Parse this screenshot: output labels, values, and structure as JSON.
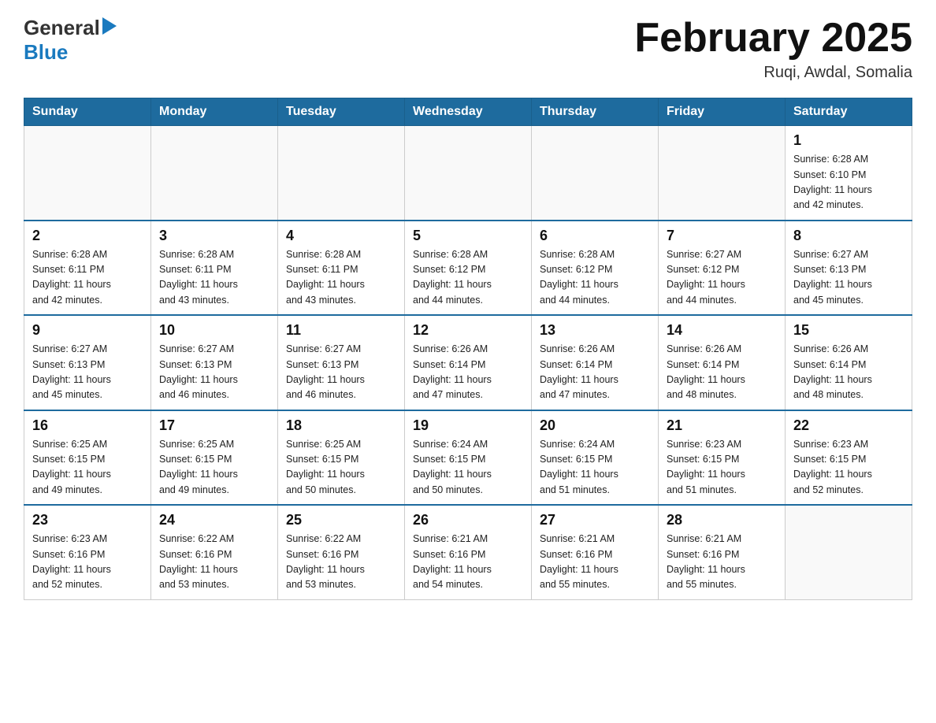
{
  "header": {
    "logo_general": "General",
    "logo_blue": "Blue",
    "month_title": "February 2025",
    "location": "Ruqi, Awdal, Somalia"
  },
  "weekdays": [
    "Sunday",
    "Monday",
    "Tuesday",
    "Wednesday",
    "Thursday",
    "Friday",
    "Saturday"
  ],
  "weeks": [
    {
      "days": [
        {
          "num": "",
          "info": ""
        },
        {
          "num": "",
          "info": ""
        },
        {
          "num": "",
          "info": ""
        },
        {
          "num": "",
          "info": ""
        },
        {
          "num": "",
          "info": ""
        },
        {
          "num": "",
          "info": ""
        },
        {
          "num": "1",
          "info": "Sunrise: 6:28 AM\nSunset: 6:10 PM\nDaylight: 11 hours\nand 42 minutes."
        }
      ]
    },
    {
      "days": [
        {
          "num": "2",
          "info": "Sunrise: 6:28 AM\nSunset: 6:11 PM\nDaylight: 11 hours\nand 42 minutes."
        },
        {
          "num": "3",
          "info": "Sunrise: 6:28 AM\nSunset: 6:11 PM\nDaylight: 11 hours\nand 43 minutes."
        },
        {
          "num": "4",
          "info": "Sunrise: 6:28 AM\nSunset: 6:11 PM\nDaylight: 11 hours\nand 43 minutes."
        },
        {
          "num": "5",
          "info": "Sunrise: 6:28 AM\nSunset: 6:12 PM\nDaylight: 11 hours\nand 44 minutes."
        },
        {
          "num": "6",
          "info": "Sunrise: 6:28 AM\nSunset: 6:12 PM\nDaylight: 11 hours\nand 44 minutes."
        },
        {
          "num": "7",
          "info": "Sunrise: 6:27 AM\nSunset: 6:12 PM\nDaylight: 11 hours\nand 44 minutes."
        },
        {
          "num": "8",
          "info": "Sunrise: 6:27 AM\nSunset: 6:13 PM\nDaylight: 11 hours\nand 45 minutes."
        }
      ]
    },
    {
      "days": [
        {
          "num": "9",
          "info": "Sunrise: 6:27 AM\nSunset: 6:13 PM\nDaylight: 11 hours\nand 45 minutes."
        },
        {
          "num": "10",
          "info": "Sunrise: 6:27 AM\nSunset: 6:13 PM\nDaylight: 11 hours\nand 46 minutes."
        },
        {
          "num": "11",
          "info": "Sunrise: 6:27 AM\nSunset: 6:13 PM\nDaylight: 11 hours\nand 46 minutes."
        },
        {
          "num": "12",
          "info": "Sunrise: 6:26 AM\nSunset: 6:14 PM\nDaylight: 11 hours\nand 47 minutes."
        },
        {
          "num": "13",
          "info": "Sunrise: 6:26 AM\nSunset: 6:14 PM\nDaylight: 11 hours\nand 47 minutes."
        },
        {
          "num": "14",
          "info": "Sunrise: 6:26 AM\nSunset: 6:14 PM\nDaylight: 11 hours\nand 48 minutes."
        },
        {
          "num": "15",
          "info": "Sunrise: 6:26 AM\nSunset: 6:14 PM\nDaylight: 11 hours\nand 48 minutes."
        }
      ]
    },
    {
      "days": [
        {
          "num": "16",
          "info": "Sunrise: 6:25 AM\nSunset: 6:15 PM\nDaylight: 11 hours\nand 49 minutes."
        },
        {
          "num": "17",
          "info": "Sunrise: 6:25 AM\nSunset: 6:15 PM\nDaylight: 11 hours\nand 49 minutes."
        },
        {
          "num": "18",
          "info": "Sunrise: 6:25 AM\nSunset: 6:15 PM\nDaylight: 11 hours\nand 50 minutes."
        },
        {
          "num": "19",
          "info": "Sunrise: 6:24 AM\nSunset: 6:15 PM\nDaylight: 11 hours\nand 50 minutes."
        },
        {
          "num": "20",
          "info": "Sunrise: 6:24 AM\nSunset: 6:15 PM\nDaylight: 11 hours\nand 51 minutes."
        },
        {
          "num": "21",
          "info": "Sunrise: 6:23 AM\nSunset: 6:15 PM\nDaylight: 11 hours\nand 51 minutes."
        },
        {
          "num": "22",
          "info": "Sunrise: 6:23 AM\nSunset: 6:15 PM\nDaylight: 11 hours\nand 52 minutes."
        }
      ]
    },
    {
      "days": [
        {
          "num": "23",
          "info": "Sunrise: 6:23 AM\nSunset: 6:16 PM\nDaylight: 11 hours\nand 52 minutes."
        },
        {
          "num": "24",
          "info": "Sunrise: 6:22 AM\nSunset: 6:16 PM\nDaylight: 11 hours\nand 53 minutes."
        },
        {
          "num": "25",
          "info": "Sunrise: 6:22 AM\nSunset: 6:16 PM\nDaylight: 11 hours\nand 53 minutes."
        },
        {
          "num": "26",
          "info": "Sunrise: 6:21 AM\nSunset: 6:16 PM\nDaylight: 11 hours\nand 54 minutes."
        },
        {
          "num": "27",
          "info": "Sunrise: 6:21 AM\nSunset: 6:16 PM\nDaylight: 11 hours\nand 55 minutes."
        },
        {
          "num": "28",
          "info": "Sunrise: 6:21 AM\nSunset: 6:16 PM\nDaylight: 11 hours\nand 55 minutes."
        },
        {
          "num": "",
          "info": ""
        }
      ]
    }
  ]
}
